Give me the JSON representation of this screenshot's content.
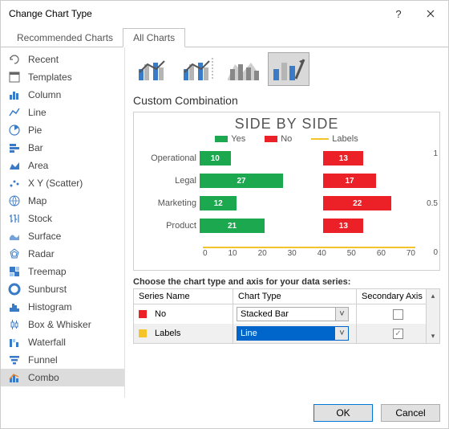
{
  "titlebar": {
    "title": "Change Chart Type"
  },
  "tabs": {
    "recommended": "Recommended Charts",
    "all": "All Charts"
  },
  "sidebar": {
    "items": [
      {
        "label": "Recent"
      },
      {
        "label": "Templates"
      },
      {
        "label": "Column"
      },
      {
        "label": "Line"
      },
      {
        "label": "Pie"
      },
      {
        "label": "Bar"
      },
      {
        "label": "Area"
      },
      {
        "label": "X Y (Scatter)"
      },
      {
        "label": "Map"
      },
      {
        "label": "Stock"
      },
      {
        "label": "Surface"
      },
      {
        "label": "Radar"
      },
      {
        "label": "Treemap"
      },
      {
        "label": "Sunburst"
      },
      {
        "label": "Histogram"
      },
      {
        "label": "Box & Whisker"
      },
      {
        "label": "Waterfall"
      },
      {
        "label": "Funnel"
      },
      {
        "label": "Combo"
      }
    ]
  },
  "main": {
    "section_title": "Custom Combination",
    "series_prompt": "Choose the chart type and axis for your data series:",
    "grid_headers": {
      "name": "Series Name",
      "type": "Chart Type",
      "secondary": "Secondary Axis"
    },
    "series": [
      {
        "color": "#ec2027",
        "name": "No",
        "type": "Stacked Bar",
        "secondary": false
      },
      {
        "color": "#f5c428",
        "name": "Labels",
        "type": "Line",
        "secondary": true
      }
    ]
  },
  "chart_data": {
    "type": "bar",
    "title": "SIDE BY SIDE",
    "legend": [
      "Yes",
      "No",
      "Labels"
    ],
    "colors": {
      "Yes": "#1ca84f",
      "No": "#ec2027",
      "Labels": "#f5c428"
    },
    "categories": [
      "Operational",
      "Legal",
      "Marketing",
      "Product"
    ],
    "series": [
      {
        "name": "Yes",
        "values": [
          10,
          27,
          12,
          21
        ]
      },
      {
        "name": "No",
        "values": [
          13,
          17,
          22,
          13
        ],
        "offset": 40
      }
    ],
    "xticks": [
      0,
      10,
      20,
      30,
      40,
      50,
      60,
      70
    ],
    "secondary_y_ticks": [
      1,
      0.5,
      0
    ],
    "xlim": [
      0,
      70
    ]
  },
  "buttons": {
    "ok": "OK",
    "cancel": "Cancel"
  }
}
